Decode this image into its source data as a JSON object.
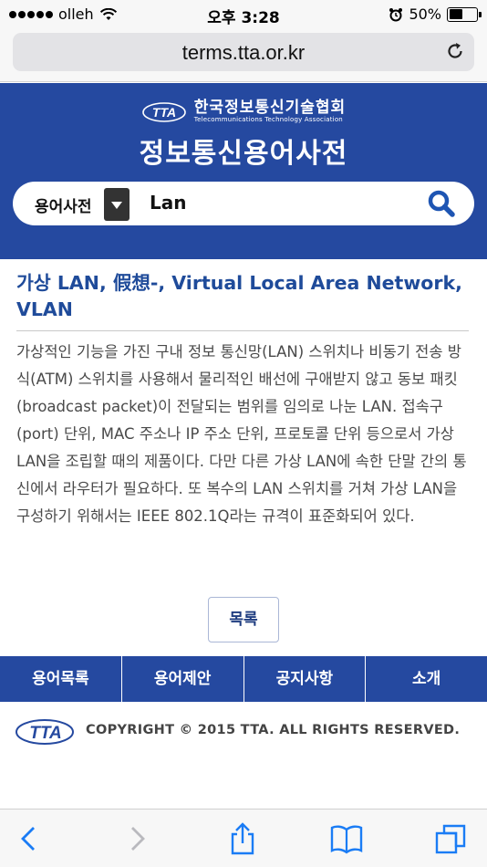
{
  "status_bar": {
    "carrier": "olleh",
    "time": "오후 3:28",
    "battery": "50%",
    "battery_level": 0.5
  },
  "browser": {
    "url": "terms.tta.or.kr"
  },
  "header": {
    "org_name_ko": "한국정보통신기술협회",
    "org_name_en": "Telecommunications Technology Association",
    "logo_text": "TTA",
    "site_title": "정보통신용어사전"
  },
  "search": {
    "category": "용어사전",
    "query": "Lan"
  },
  "term": {
    "title": "가상 LAN, 假想-, Virtual Local Area Network, VLAN",
    "description": "가상적인 기능을 가진 구내 정보 통신망(LAN) 스위치나 비동기 전송 방식(ATM) 스위치를 사용해서 물리적인 배선에 구애받지 않고 동보 패킷(broadcast packet)이 전달되는 범위를 임의로 나눈 LAN. 접속구(port) 단위, MAC 주소나 IP 주소 단위, 프로토콜 단위 등으로서 가상 LAN을 조립할 때의 제품이다. 다만 다른 가상 LAN에 속한 단말 간의 통신에서 라우터가 필요하다. 또 복수의 LAN 스위치를 거쳐 가상 LAN을 구성하기 위해서는 IEEE 802.1Q라는 규격이 표준화되어 있다."
  },
  "list_button": "목록",
  "nav": [
    "용어목록",
    "용어제안",
    "공지사항",
    "소개"
  ],
  "footer": {
    "logo_text": "TTA",
    "copyright": "COPYRIGHT © 2015 TTA. ALL RIGHTS RESERVED."
  },
  "colors": {
    "brand_blue": "#2549a0",
    "title_blue": "#1f4b9a",
    "ios_blue": "#1a7cf5"
  },
  "icons": [
    "wifi-icon",
    "alarm-icon",
    "battery-icon",
    "reload-icon",
    "search-icon",
    "back-icon",
    "forward-icon",
    "share-icon",
    "bookmarks-icon",
    "tabs-icon"
  ]
}
